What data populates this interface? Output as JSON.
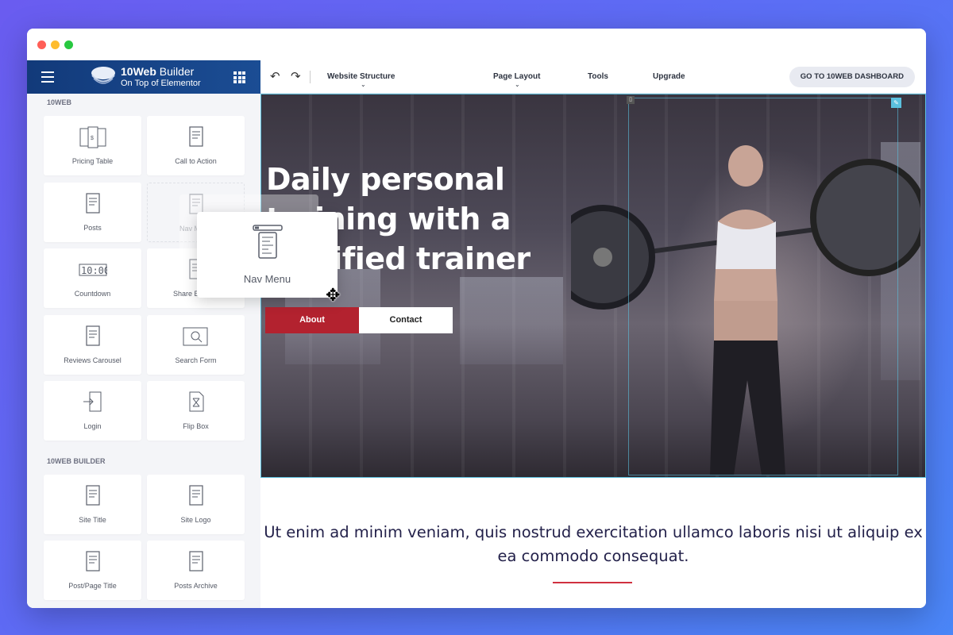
{
  "window": {
    "traffic_lights": [
      "#ff5f57",
      "#febc2e",
      "#28c840"
    ]
  },
  "sidebar": {
    "brand_name_bold": "10Web",
    "brand_name": "Builder",
    "brand_tagline": "On Top of Elementor",
    "menu_icon": "hamburger-icon",
    "apps_icon": "grid-icon",
    "sections": [
      {
        "title": "10WEB",
        "widgets": [
          {
            "label": "Pricing Table",
            "icon": "pricing-table-icon"
          },
          {
            "label": "Call to Action",
            "icon": "call-to-action-icon"
          },
          {
            "label": "Posts",
            "icon": "posts-icon"
          },
          {
            "label": "Nav Menu",
            "icon": "nav-menu-icon"
          },
          {
            "label": "Countdown",
            "icon": "countdown-icon"
          },
          {
            "label": "Share Buttons",
            "icon": "share-buttons-icon"
          },
          {
            "label": "Reviews Carousel",
            "icon": "reviews-carousel-icon"
          },
          {
            "label": "Search Form",
            "icon": "search-form-icon"
          },
          {
            "label": "Login",
            "icon": "login-icon"
          },
          {
            "label": "Flip Box",
            "icon": "flip-box-icon"
          }
        ]
      },
      {
        "title": "10WEB BUILDER",
        "widgets": [
          {
            "label": "Site Title",
            "icon": "site-title-icon"
          },
          {
            "label": "Site Logo",
            "icon": "site-logo-icon"
          },
          {
            "label": "Post/Page Title",
            "icon": "post-title-icon"
          },
          {
            "label": "Posts Archive",
            "icon": "posts-archive-icon"
          }
        ]
      }
    ]
  },
  "toolbar": {
    "undo": "undo-icon",
    "redo": "redo-icon",
    "website_structure": "Website Structure",
    "page_layout": "Page Layout",
    "tools": "Tools",
    "upgrade": "Upgrade",
    "dashboard_button": "GO TO 10WEB DASHBOARD"
  },
  "hero": {
    "heading": "Daily personal training with a certified trainer",
    "about_button": "About",
    "contact_button": "Contact"
  },
  "content": {
    "paragraph": "Ut enim ad minim veniam, quis nostrud exercitation ullamco laboris nisi ut aliquip ex ea commodo consequat.",
    "accent": "#d0313f"
  },
  "drag": {
    "label": "Nav Menu"
  },
  "colors": {
    "brand": "#123a7a",
    "button_primary": "#b3222f",
    "selection": "#5bc0de"
  }
}
